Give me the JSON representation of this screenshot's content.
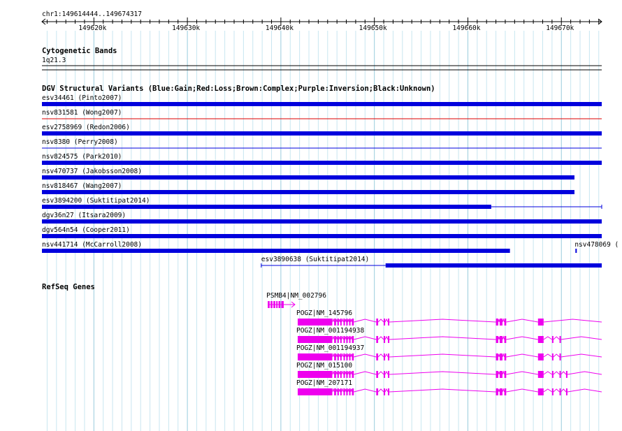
{
  "ruler": {
    "region": "chr1:149614444..149674317",
    "start": 149614444,
    "end": 149674317,
    "ticks": [
      "149620k",
      "149630k",
      "149640k",
      "149650k",
      "149660k",
      "149670k"
    ]
  },
  "cytoband": {
    "title": "Cytogenetic Bands",
    "band": "1q21.3"
  },
  "dgv": {
    "title": "DGV Structural Variants (Blue:Gain;Red:Loss;Brown:Complex;Purple:Inversion;Black:Unknown)",
    "colors": {
      "gain": "#0000dd",
      "loss": "#dd0000"
    },
    "features": [
      {
        "label": "esv34461 (Pinto2007)",
        "type": "gain",
        "style": "thick",
        "start": 149614444,
        "end": 149674317
      },
      {
        "label": "nsv831581 (Wong2007)",
        "type": "loss",
        "style": "thin",
        "start": 149614444,
        "end": 149674317
      },
      {
        "label": "esv2758969 (Redon2006)",
        "type": "gain",
        "style": "thick",
        "start": 149614444,
        "end": 149674317
      },
      {
        "label": "nsv8380 (Perry2008)",
        "type": "gain",
        "style": "thin",
        "start": 149614444,
        "end": 149674317
      },
      {
        "label": "nsv824575 (Park2010)",
        "type": "gain",
        "style": "thick",
        "start": 149614444,
        "end": 149674317
      },
      {
        "label": "nsv470737 (Jakobsson2008)",
        "type": "gain",
        "style": "thick",
        "start": 149614444,
        "end": 149671400
      },
      {
        "label": "nsv818467 (Wang2007)",
        "type": "gain",
        "style": "thick",
        "start": 149614444,
        "end": 149671400
      },
      {
        "label": "esv3894200 (Suktitipat2014)",
        "type": "gain",
        "style": "split",
        "start": 149614444,
        "end": 149674317,
        "thickEnd": 149662500
      },
      {
        "label": "dgv36n27 (Itsara2009)",
        "type": "gain",
        "style": "thick",
        "start": 149614444,
        "end": 149674317
      },
      {
        "label": "dgv564n54 (Cooper2011)",
        "type": "gain",
        "style": "thick",
        "start": 149614444,
        "end": 149674317
      },
      {
        "label": "nsv441714 (McCarroll2008)",
        "type": "gain",
        "style": "thick",
        "start": 149614444,
        "end": 149664500
      },
      {
        "label": "nsv478069 (",
        "type": "gain",
        "style": "tick",
        "start": 149671500,
        "end": 149671550
      },
      {
        "label": "esv3890638 (Suktitipat2014)",
        "type": "gain",
        "style": "split2",
        "start": 149637900,
        "end": 149674317,
        "thickStart": 149651200
      }
    ]
  },
  "refseq": {
    "title": "RefSeq Genes",
    "color": "#ee00ee",
    "genes": [
      {
        "label": "PSMB4|NM_002796",
        "start": 149638600,
        "end": 149641500,
        "strand": "+",
        "exons": [
          [
            149638600,
            149638800
          ],
          [
            149638900,
            149639100
          ],
          [
            149639200,
            149639400
          ],
          [
            149639500,
            149639650
          ],
          [
            149639750,
            149639950
          ],
          [
            149640050,
            149640300
          ]
        ]
      },
      {
        "label": "POGZ|NM_145796",
        "start": 149641800,
        "end": 149674317,
        "strand": "-",
        "exons": [
          [
            149641800,
            149645500
          ],
          [
            149645700,
            149645900
          ],
          [
            149646050,
            149646200
          ],
          [
            149646350,
            149646500
          ],
          [
            149646700,
            149646850
          ],
          [
            149647000,
            149647150
          ],
          [
            149647300,
            149647450
          ],
          [
            149647600,
            149647800
          ],
          [
            149650200,
            149650400
          ],
          [
            149651000,
            149651150
          ],
          [
            149651450,
            149651600
          ],
          [
            149663000,
            149663250
          ],
          [
            149663400,
            149663700
          ],
          [
            149663900,
            149664100
          ],
          [
            149667500,
            149668100
          ]
        ]
      },
      {
        "label": "POGZ|NM_001194938",
        "start": 149641800,
        "end": 149674317,
        "strand": "-",
        "exons": [
          [
            149641800,
            149645500
          ],
          [
            149645700,
            149645900
          ],
          [
            149646050,
            149646200
          ],
          [
            149646350,
            149646500
          ],
          [
            149646700,
            149646850
          ],
          [
            149647000,
            149647150
          ],
          [
            149647300,
            149647450
          ],
          [
            149647600,
            149647800
          ],
          [
            149650200,
            149650400
          ],
          [
            149651000,
            149651150
          ],
          [
            149651450,
            149651600
          ],
          [
            149663000,
            149663250
          ],
          [
            149663400,
            149663700
          ],
          [
            149663900,
            149664100
          ],
          [
            149667500,
            149668100
          ],
          [
            149669000,
            149669150
          ],
          [
            149669800,
            149669950
          ]
        ]
      },
      {
        "label": "POGZ|NM_001194937",
        "start": 149641800,
        "end": 149674317,
        "strand": "-",
        "exons": [
          [
            149641800,
            149645500
          ],
          [
            149645700,
            149645900
          ],
          [
            149646050,
            149646200
          ],
          [
            149646350,
            149646500
          ],
          [
            149646700,
            149646850
          ],
          [
            149647000,
            149647150
          ],
          [
            149647300,
            149647450
          ],
          [
            149647600,
            149647800
          ],
          [
            149650200,
            149650400
          ],
          [
            149651000,
            149651150
          ],
          [
            149651450,
            149651600
          ],
          [
            149663000,
            149663250
          ],
          [
            149663400,
            149663700
          ],
          [
            149663900,
            149664100
          ],
          [
            149667500,
            149668100
          ],
          [
            149669000,
            149669150
          ],
          [
            149669800,
            149669950
          ]
        ]
      },
      {
        "label": "POGZ|NM_015100",
        "start": 149641800,
        "end": 149674317,
        "strand": "-",
        "exons": [
          [
            149641800,
            149645500
          ],
          [
            149645700,
            149645900
          ],
          [
            149646050,
            149646200
          ],
          [
            149646350,
            149646500
          ],
          [
            149646700,
            149646850
          ],
          [
            149647000,
            149647150
          ],
          [
            149647300,
            149647450
          ],
          [
            149647600,
            149647800
          ],
          [
            149650200,
            149650400
          ],
          [
            149651000,
            149651150
          ],
          [
            149651450,
            149651600
          ],
          [
            149663000,
            149663250
          ],
          [
            149663400,
            149663700
          ],
          [
            149663900,
            149664100
          ],
          [
            149667500,
            149668100
          ],
          [
            149669000,
            149669150
          ],
          [
            149669800,
            149669950
          ],
          [
            149670500,
            149670650
          ]
        ]
      },
      {
        "label": "POGZ|NM_207171",
        "start": 149641800,
        "end": 149674317,
        "strand": "-",
        "exons": [
          [
            149641800,
            149645500
          ],
          [
            149645700,
            149645900
          ],
          [
            149646050,
            149646200
          ],
          [
            149646350,
            149646500
          ],
          [
            149646700,
            149646850
          ],
          [
            149647000,
            149647150
          ],
          [
            149647300,
            149647450
          ],
          [
            149647600,
            149647800
          ],
          [
            149650200,
            149650400
          ],
          [
            149651000,
            149651150
          ],
          [
            149651450,
            149651600
          ],
          [
            149663000,
            149663250
          ],
          [
            149663400,
            149663700
          ],
          [
            149663900,
            149664100
          ],
          [
            149667500,
            149668100
          ],
          [
            149669000,
            149669150
          ],
          [
            149669800,
            149669950
          ],
          [
            149670500,
            149670650
          ]
        ]
      }
    ]
  }
}
